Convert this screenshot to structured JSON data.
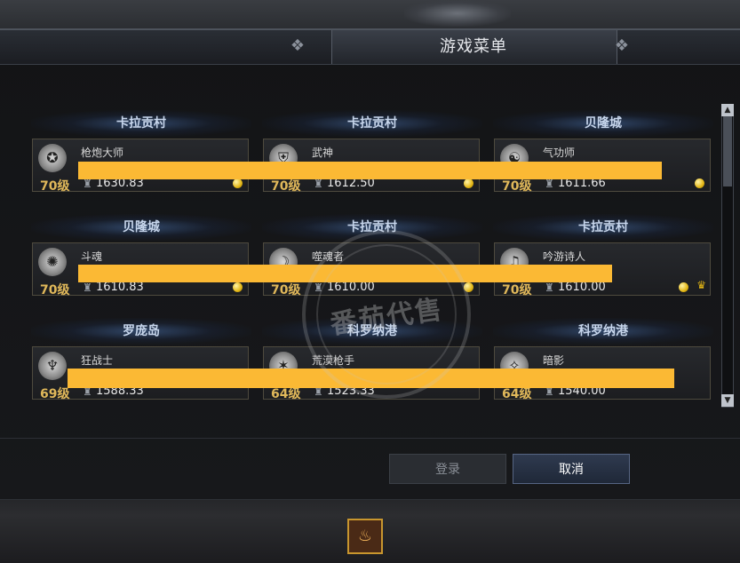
{
  "window": {
    "title": "游戏菜单"
  },
  "servers": [
    "卡拉贡村",
    "卡拉贡村",
    "贝隆城",
    "贝隆城",
    "卡拉贡村",
    "卡拉贡村",
    "罗庞岛",
    "科罗纳港",
    "科罗纳港"
  ],
  "characters": [
    {
      "name": "枪炮大师",
      "level": "70级",
      "power": "1630.83",
      "emblem": "gunner-emblem-icon"
    },
    {
      "name": "武神",
      "level": "70级",
      "power": "1612.50",
      "emblem": "martial-god-emblem-icon"
    },
    {
      "name": "气功师",
      "level": "70级",
      "power": "1611.66",
      "emblem": "qigong-emblem-icon"
    },
    {
      "name": "斗魂",
      "level": "70级",
      "power": "1610.83",
      "emblem": "fighter-soul-emblem-icon"
    },
    {
      "name": "噬魂者",
      "level": "70级",
      "power": "1610.00",
      "emblem": "soul-eater-emblem-icon"
    },
    {
      "name": "吟游诗人",
      "level": "70级",
      "power": "1610.00",
      "emblem": "bard-emblem-icon"
    },
    {
      "name": "狂战士",
      "level": "69级",
      "power": "1588.33",
      "emblem": "berserker-emblem-icon"
    },
    {
      "name": "荒漠枪手",
      "level": "64级",
      "power": "1523.33",
      "emblem": "desert-gunner-emblem-icon"
    },
    {
      "name": "暗影",
      "level": "64级",
      "power": "1540.00",
      "emblem": "shadow-emblem-icon"
    }
  ],
  "watermark": {
    "text": "番茄代售"
  },
  "buttons": {
    "login": "登录",
    "cancel": "取消"
  },
  "colors": {
    "level": "#e0b85a",
    "redaction": "#fbb934",
    "card_border": "#4e4a3e"
  }
}
